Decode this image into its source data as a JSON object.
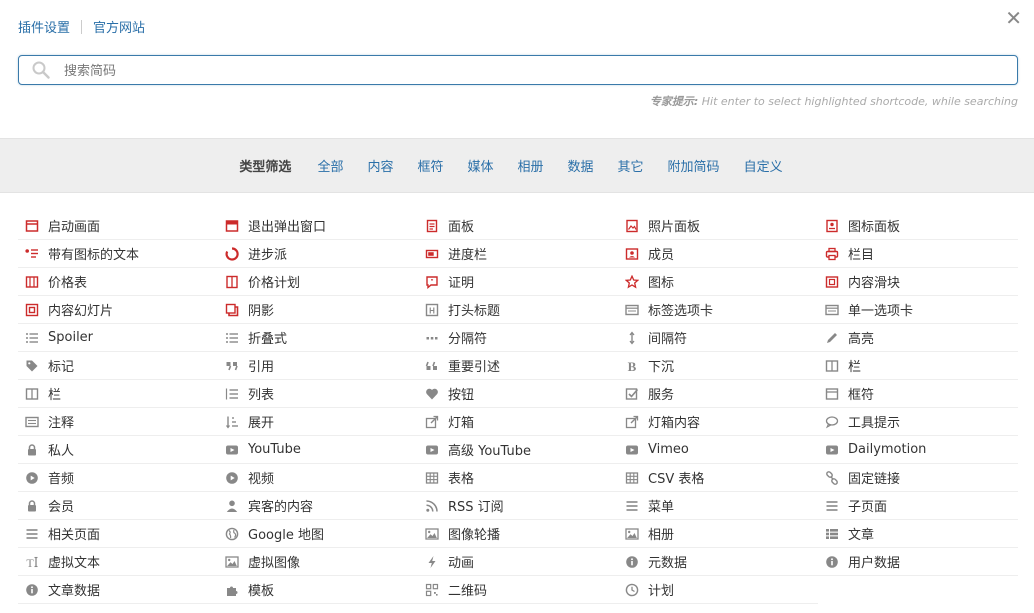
{
  "top_links": [
    "插件设置",
    "官方网站"
  ],
  "search": {
    "placeholder": "搜索简码",
    "value": ""
  },
  "tip": {
    "label": "专家提示:",
    "text": "Hit enter to select highlighted shortcode, while searching"
  },
  "filter": {
    "label": "类型筛选",
    "items": [
      "全部",
      "内容",
      "框符",
      "媒体",
      "相册",
      "数据",
      "其它",
      "附加简码",
      "自定义"
    ]
  },
  "colors": {
    "accent": "#2a6fa8",
    "icon_red": "#cc2b2b",
    "icon_gray": "#888888"
  },
  "items": [
    {
      "label": "启动画面",
      "icon": "window-icon",
      "color": "red"
    },
    {
      "label": "退出弹出窗口",
      "icon": "popup-window-icon",
      "color": "red"
    },
    {
      "label": "面板",
      "icon": "document-icon",
      "color": "red"
    },
    {
      "label": "照片面板",
      "icon": "image-icon",
      "color": "red"
    },
    {
      "label": "图标面板",
      "icon": "icon-panel-icon",
      "color": "red"
    },
    {
      "label": "带有图标的文本",
      "icon": "icon-text-icon",
      "color": "red"
    },
    {
      "label": "进步派",
      "icon": "progress-pie-icon",
      "color": "red"
    },
    {
      "label": "进度栏",
      "icon": "progress-bar-icon",
      "color": "red"
    },
    {
      "label": "成员",
      "icon": "member-icon",
      "color": "red"
    },
    {
      "label": "栏目",
      "icon": "printer-icon",
      "color": "red"
    },
    {
      "label": "价格表",
      "icon": "pricing-table-icon",
      "color": "red"
    },
    {
      "label": "价格计划",
      "icon": "pricing-plan-icon",
      "color": "red"
    },
    {
      "label": "证明",
      "icon": "testimonial-icon",
      "color": "red"
    },
    {
      "label": "图标",
      "icon": "star-icon",
      "color": "red"
    },
    {
      "label": "内容滑块",
      "icon": "content-slider-icon",
      "color": "red"
    },
    {
      "label": "内容幻灯片",
      "icon": "content-slide-icon",
      "color": "red"
    },
    {
      "label": "阴影",
      "icon": "shadow-icon",
      "color": "red"
    },
    {
      "label": "打头标题",
      "icon": "heading-icon",
      "color": "gray"
    },
    {
      "label": "标签选项卡",
      "icon": "tabs-icon",
      "color": "gray"
    },
    {
      "label": "单一选项卡",
      "icon": "single-tab-icon",
      "color": "gray"
    },
    {
      "label": "Spoiler",
      "icon": "list-icon",
      "color": "gray"
    },
    {
      "label": "折叠式",
      "icon": "list-icon",
      "color": "gray"
    },
    {
      "label": "分隔符",
      "icon": "ellipsis-icon",
      "color": "gray"
    },
    {
      "label": "间隔符",
      "icon": "vertical-arrows-icon",
      "color": "gray"
    },
    {
      "label": "高亮",
      "icon": "pencil-icon",
      "color": "gray"
    },
    {
      "label": "标记",
      "icon": "tag-icon",
      "color": "gray"
    },
    {
      "label": "引用",
      "icon": "quote-icon",
      "color": "gray"
    },
    {
      "label": "重要引述",
      "icon": "quote-left-icon",
      "color": "gray"
    },
    {
      "label": "下沉",
      "icon": "bold-icon",
      "color": "gray"
    },
    {
      "label": "栏",
      "icon": "columns-icon",
      "color": "gray"
    },
    {
      "label": "栏",
      "icon": "columns-icon",
      "color": "gray"
    },
    {
      "label": "列表",
      "icon": "list-ul-icon",
      "color": "gray"
    },
    {
      "label": "按钮",
      "icon": "heart-icon",
      "color": "gray"
    },
    {
      "label": "服务",
      "icon": "check-square-icon",
      "color": "gray"
    },
    {
      "label": "框符",
      "icon": "box-icon",
      "color": "gray"
    },
    {
      "label": "注释",
      "icon": "note-icon",
      "color": "gray"
    },
    {
      "label": "展开",
      "icon": "sort-icon",
      "color": "gray"
    },
    {
      "label": "灯箱",
      "icon": "external-link-icon",
      "color": "gray"
    },
    {
      "label": "灯箱内容",
      "icon": "external-link-icon",
      "color": "gray"
    },
    {
      "label": "工具提示",
      "icon": "comment-icon",
      "color": "gray"
    },
    {
      "label": "私人",
      "icon": "lock-icon",
      "color": "gray"
    },
    {
      "label": "YouTube",
      "icon": "youtube-icon",
      "color": "gray"
    },
    {
      "label": "高级 YouTube",
      "icon": "youtube-icon",
      "color": "gray"
    },
    {
      "label": "Vimeo",
      "icon": "video-icon",
      "color": "gray"
    },
    {
      "label": "Dailymotion",
      "icon": "video-icon",
      "color": "gray"
    },
    {
      "label": "音频",
      "icon": "play-circle-icon",
      "color": "gray"
    },
    {
      "label": "视频",
      "icon": "play-circle-icon",
      "color": "gray"
    },
    {
      "label": "表格",
      "icon": "table-icon",
      "color": "gray"
    },
    {
      "label": "CSV 表格",
      "icon": "table-icon",
      "color": "gray"
    },
    {
      "label": "固定链接",
      "icon": "link-icon",
      "color": "gray"
    },
    {
      "label": "会员",
      "icon": "lock-icon",
      "color": "gray"
    },
    {
      "label": "宾客的内容",
      "icon": "user-icon",
      "color": "gray"
    },
    {
      "label": "RSS 订阅",
      "icon": "rss-icon",
      "color": "gray"
    },
    {
      "label": "菜单",
      "icon": "bars-icon",
      "color": "gray"
    },
    {
      "label": "子页面",
      "icon": "bars-icon",
      "color": "gray"
    },
    {
      "label": "相关页面",
      "icon": "bars-icon",
      "color": "gray"
    },
    {
      "label": "Google 地图",
      "icon": "globe-icon",
      "color": "gray"
    },
    {
      "label": "图像轮播",
      "icon": "picture-icon",
      "color": "gray"
    },
    {
      "label": "相册",
      "icon": "picture-icon",
      "color": "gray"
    },
    {
      "label": "文章",
      "icon": "th-list-icon",
      "color": "gray"
    },
    {
      "label": "虚拟文本",
      "icon": "text-height-icon",
      "color": "gray"
    },
    {
      "label": "虚拟图像",
      "icon": "picture-icon",
      "color": "gray"
    },
    {
      "label": "动画",
      "icon": "bolt-icon",
      "color": "gray"
    },
    {
      "label": "元数据",
      "icon": "info-icon",
      "color": "gray"
    },
    {
      "label": "用户数据",
      "icon": "info-icon",
      "color": "gray"
    },
    {
      "label": "文章数据",
      "icon": "info-icon",
      "color": "gray"
    },
    {
      "label": "模板",
      "icon": "puzzle-icon",
      "color": "gray"
    },
    {
      "label": "二维码",
      "icon": "qrcode-icon",
      "color": "gray"
    },
    {
      "label": "计划",
      "icon": "clock-icon",
      "color": "gray"
    }
  ]
}
